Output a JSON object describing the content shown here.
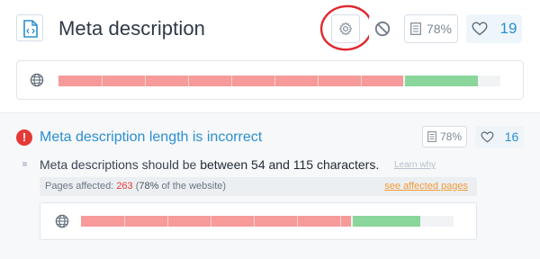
{
  "header": {
    "title": "Meta description",
    "doc_icon": "file-code-icon",
    "settings_icon": "gear-icon",
    "block_icon": "block-icon",
    "pages_pct": "78%",
    "likes": "19",
    "highlight_color": "#e0282e"
  },
  "overview_bar": {
    "icon": "globe-icon",
    "red_fraction": 0.78,
    "green_fraction": 0.165,
    "red_color": "#f69a9a",
    "green_color": "#8ad69b"
  },
  "issue": {
    "icon": "exclamation-icon",
    "title": "Meta description length is incorrect",
    "pages_pct": "78%",
    "likes": "16",
    "desc_prefix": "Meta descriptions should be ",
    "desc_highlight": "between 54 and 115 characters.",
    "learn_why": "Learn why",
    "affected_label": "Pages affected: ",
    "affected_count": "263",
    "affected_open": " (",
    "affected_pct": "78%",
    "affected_suffix": " of the website)",
    "see_affected": "see affected pages",
    "bar_red_fraction": 0.725,
    "bar_green_fraction": 0.18
  }
}
